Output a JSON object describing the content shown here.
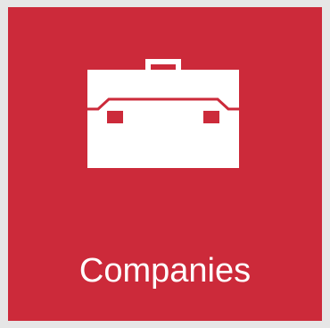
{
  "tile": {
    "label": "Companies",
    "icon": "briefcase-icon",
    "background_color": "#cc2a3a",
    "foreground_color": "#ffffff"
  }
}
